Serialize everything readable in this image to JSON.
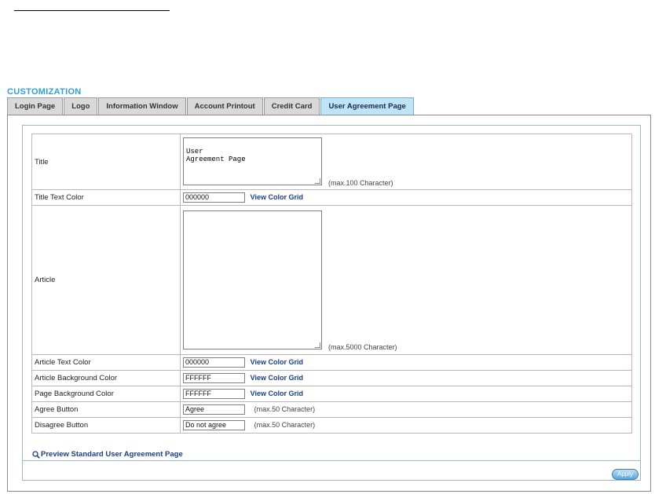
{
  "section_title": "CUSTOMIZATION",
  "tabs": [
    {
      "label": "Login Page"
    },
    {
      "label": "Logo"
    },
    {
      "label": "Information Window"
    },
    {
      "label": "Account Printout"
    },
    {
      "label": "Credit Card"
    },
    {
      "label": "User Agreement Page",
      "active": true
    }
  ],
  "form": {
    "title": {
      "label": "Title",
      "value": "User\nAgreement Page",
      "hint": "(max.100 Character)"
    },
    "title_text_color": {
      "label": "Title Text Color",
      "value": "000000",
      "link": "View Color Grid"
    },
    "article": {
      "label": "Article",
      "value": "",
      "hint": "(max.5000 Character)"
    },
    "article_text_color": {
      "label": "Article Text Color",
      "value": "000000",
      "link": "View Color Grid"
    },
    "article_bg_color": {
      "label": "Article Background Color",
      "value": "FFFFFF",
      "link": "View Color Grid"
    },
    "page_bg_color": {
      "label": "Page Background Color",
      "value": "FFFFFF",
      "link": "View Color Grid"
    },
    "agree_button": {
      "label": "Agree Button",
      "value": "Agree",
      "hint": "(max.50 Character)"
    },
    "disagree_button": {
      "label": "Disagree Button",
      "value": "Do not agree",
      "hint": "(max.50 Character)"
    }
  },
  "preview_link": "Preview Standard User Agreement Page",
  "apply_label": "Apply",
  "colors": {
    "accent": "#2f9fd8",
    "active_tab": "#bfe3f7",
    "link": "#1a3f8a"
  }
}
